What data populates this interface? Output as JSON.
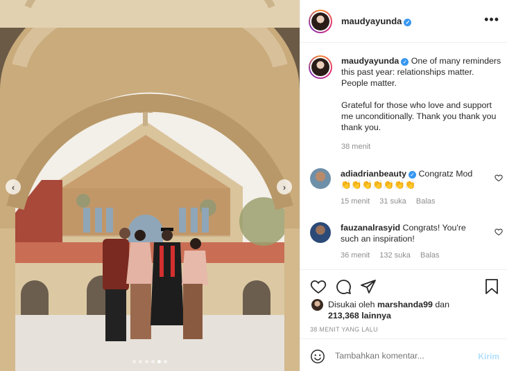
{
  "post": {
    "username": "maudyayunda",
    "verified_mark": "✓",
    "more_icon": "more-horizontal-icon",
    "more_label": "•••",
    "caption_p1": "One of many reminders this past year: relationships matter. People matter.",
    "caption_p2": "Grateful for those who love and support me unconditionally. Thank you thank you thank you.",
    "caption_time": "38 menit"
  },
  "carousel": {
    "prev": "‹",
    "next": "›",
    "slide_count": 6,
    "active_slide": 4
  },
  "comments": [
    {
      "username": "adiadrianbeauty",
      "verified": true,
      "text": "Congratz Mod 👏👏👏👏👏👏👏",
      "time": "15 menit",
      "likes": "31 suka",
      "reply": "Balas"
    },
    {
      "username": "fauzanalrasyid",
      "verified": false,
      "text": "Congrats! You're such an inspiration!",
      "time": "36 menit",
      "likes": "132 suka",
      "reply": "Balas"
    }
  ],
  "actions": {
    "icons": [
      "heart-icon",
      "comment-icon",
      "share-icon",
      "bookmark-icon"
    ],
    "liked_by_prefix": "Disukai oleh",
    "liked_by_user": "marshanda99",
    "liked_by_and": "dan",
    "liked_by_count": "213,368 lainnya",
    "posted_ago": "38 MENIT YANG LALU"
  },
  "add_comment": {
    "placeholder": "Tambahkan komentar...",
    "post_label": "Kirim"
  },
  "colors": {
    "accent": "#3897f0",
    "post_disabled": "#b2dffc",
    "muted": "#8e8e8e"
  }
}
